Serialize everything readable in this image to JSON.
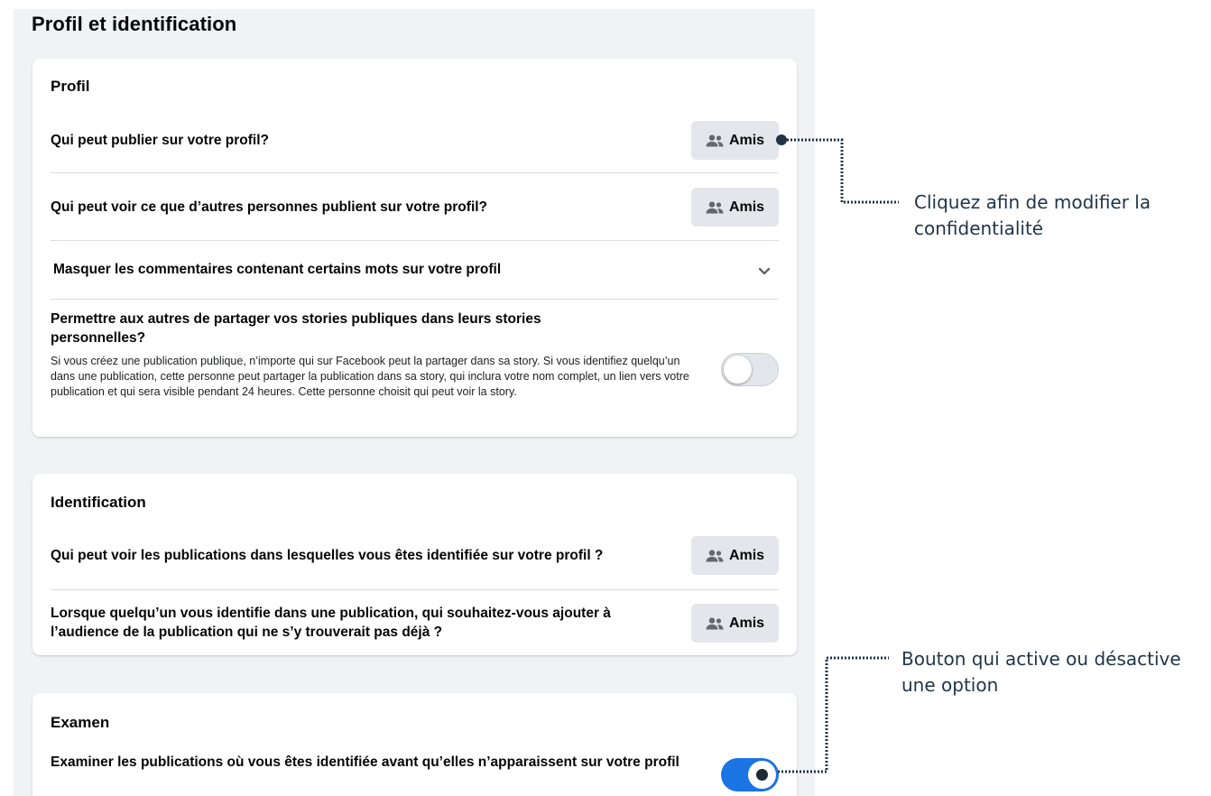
{
  "page": {
    "title": "Profil et identification"
  },
  "profil": {
    "title": "Profil",
    "rows": [
      {
        "label": "Qui peut publier sur votre profil?",
        "button": "Amis"
      },
      {
        "label": "Qui peut voir ce que d’autres personnes publient sur votre profil?",
        "button": "Amis"
      }
    ],
    "hide_comments": {
      "label": "Masquer les commentaires contenant certains mots sur votre profil",
      "expanded": false
    },
    "share_stories": {
      "title": "Permettre aux autres de partager vos stories publiques dans leurs stories personnelles?",
      "description": "Si vous créez une publication publique, n’importe qui sur Facebook peut la partager dans sa story. Si vous identifiez quelqu’un dans une publication, cette personne peut partager la publication dans sa story, qui inclura votre nom complet, un lien vers votre publication et qui sera visible pendant 24 heures. Cette personne choisit qui peut voir la story.",
      "enabled": false
    }
  },
  "identification": {
    "title": "Identification",
    "rows": [
      {
        "label": "Qui peut voir les publications dans lesquelles vous êtes identifiée sur votre profil ?",
        "button": "Amis"
      },
      {
        "label": "Lorsque quelqu’un vous identifie dans une publication, qui souhaitez-vous ajouter à l’audience de la publication qui ne s’y trouverait pas déjà ?",
        "button": "Amis"
      }
    ]
  },
  "examen": {
    "title": "Examen",
    "review_tags": {
      "label": "Examiner les publications où vous êtes identifiée avant qu’elles n’apparaissent sur votre profil",
      "enabled": true
    }
  },
  "callouts": [
    {
      "text": "Cliquez afin de modifier la confidentialité"
    },
    {
      "text": "Bouton qui active ou désactive une option"
    }
  ],
  "icons": {
    "amis": "friends-icon",
    "expand": "chevron-down-icon"
  },
  "colors": {
    "toggle_on": "#1b74e4",
    "callout": "#1f3448",
    "background": "#f0f2f5"
  }
}
